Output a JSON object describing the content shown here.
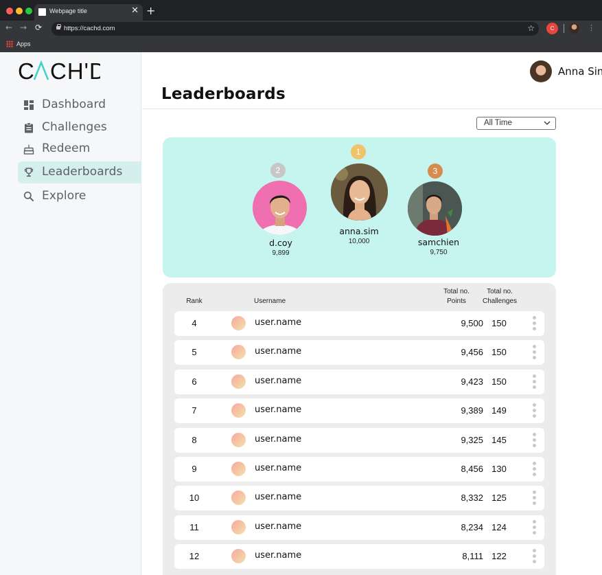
{
  "browser": {
    "tab_title": "Webpage title",
    "tab_close": "✕",
    "new_tab": "+",
    "url": "https://cachd.com",
    "bookmark_apps": "Apps",
    "extension_badge": "C"
  },
  "sidebar": {
    "logo": "CACH'D",
    "items": [
      {
        "label": "Dashboard",
        "icon": "dashboard-icon"
      },
      {
        "label": "Challenges",
        "icon": "clipboard-icon"
      },
      {
        "label": "Redeem",
        "icon": "cake-icon"
      },
      {
        "label": "Leaderboards",
        "icon": "trophy-icon",
        "active": true
      },
      {
        "label": "Explore",
        "icon": "search-icon"
      }
    ]
  },
  "header": {
    "title": "Leaderboards",
    "user_name": "Anna Sim"
  },
  "filter": {
    "selected": "All Time"
  },
  "podium": [
    {
      "rank": "2",
      "username": "d.coy",
      "points": "9,899",
      "badge_color": "#c7c7c7"
    },
    {
      "rank": "1",
      "username": "anna.sim",
      "points": "10,000",
      "badge_color": "#efc36a"
    },
    {
      "rank": "3",
      "username": "samchien",
      "points": "9,750",
      "badge_color": "#d78c4f"
    }
  ],
  "table": {
    "headers": {
      "rank": "Rank",
      "username": "Username",
      "points_line1": "Total no.",
      "points_line2": "Points",
      "challenges_line1": "Total no.",
      "challenges_line2": "Challenges"
    },
    "rows": [
      {
        "rank": "4",
        "username": "user.name",
        "points": "9,500",
        "challenges": "150"
      },
      {
        "rank": "5",
        "username": "user.name",
        "points": "9,456",
        "challenges": "150"
      },
      {
        "rank": "6",
        "username": "user.name",
        "points": "9,423",
        "challenges": "150"
      },
      {
        "rank": "7",
        "username": "user.name",
        "points": "9,389",
        "challenges": "149"
      },
      {
        "rank": "8",
        "username": "user.name",
        "points": "9,325",
        "challenges": "145"
      },
      {
        "rank": "9",
        "username": "user.name",
        "points": "8,456",
        "challenges": "130"
      },
      {
        "rank": "10",
        "username": "user.name",
        "points": "8,332",
        "challenges": "125"
      },
      {
        "rank": "11",
        "username": "user.name",
        "points": "8,234",
        "challenges": "124"
      },
      {
        "rank": "12",
        "username": "user.name",
        "points": "8,111",
        "challenges": "122"
      }
    ]
  },
  "colors": {
    "accent": "#3fd1c6",
    "active_nav_bg": "#d5efec",
    "podium_bg": "#c6f4ef"
  }
}
